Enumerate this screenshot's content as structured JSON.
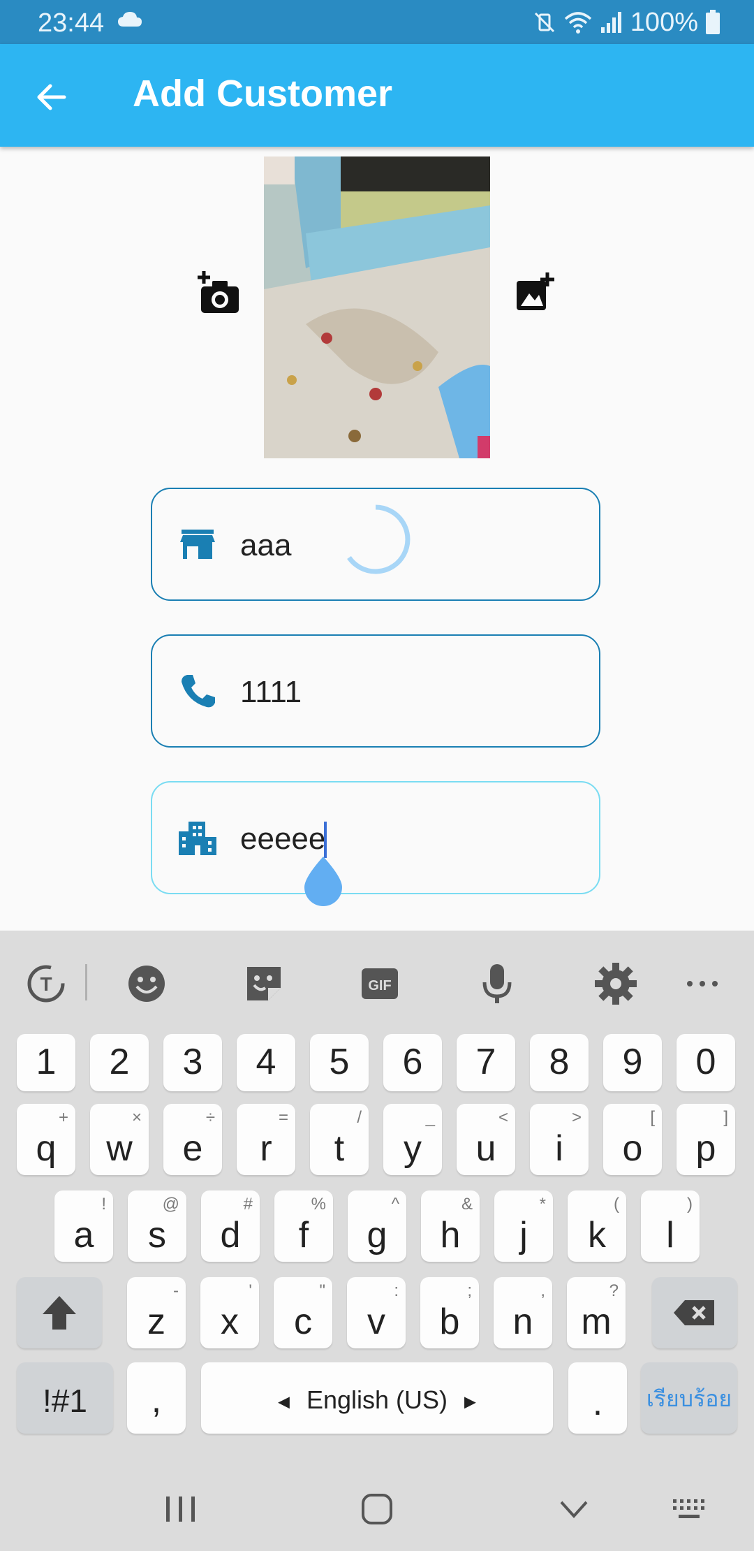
{
  "status": {
    "time": "23:44",
    "battery": "100%"
  },
  "appbar": {
    "title": "Add Customer",
    "back_icon": "arrow-back-icon"
  },
  "photo": {
    "camera_icon": "add-photo-camera-icon",
    "gallery_icon": "add-photo-gallery-icon"
  },
  "fields": {
    "shop": {
      "value": "aaa",
      "icon": "store-icon"
    },
    "phone": {
      "value": "1111",
      "icon": "phone-icon"
    },
    "address": {
      "value": "eeeee",
      "icon": "city-building-icon"
    }
  },
  "colors": {
    "appbar": "#2db5f2",
    "statusbar": "#2a8bc2",
    "field_border": "#1a7fb3",
    "field_focus": "#7adcf2",
    "accent": "#3a8fe0"
  },
  "keyboard": {
    "numbers": [
      "1",
      "2",
      "3",
      "4",
      "5",
      "6",
      "7",
      "8",
      "9",
      "0"
    ],
    "row1": [
      {
        "k": "q",
        "s": "+"
      },
      {
        "k": "w",
        "s": "×"
      },
      {
        "k": "e",
        "s": "÷"
      },
      {
        "k": "r",
        "s": "="
      },
      {
        "k": "t",
        "s": "/"
      },
      {
        "k": "y",
        "s": "_"
      },
      {
        "k": "u",
        "s": "<"
      },
      {
        "k": "i",
        "s": ">"
      },
      {
        "k": "o",
        "s": "["
      },
      {
        "k": "p",
        "s": "]"
      }
    ],
    "row2": [
      {
        "k": "a",
        "s": "!"
      },
      {
        "k": "s",
        "s": "@"
      },
      {
        "k": "d",
        "s": "#"
      },
      {
        "k": "f",
        "s": "%"
      },
      {
        "k": "g",
        "s": "^"
      },
      {
        "k": "h",
        "s": "&"
      },
      {
        "k": "j",
        "s": "*"
      },
      {
        "k": "k",
        "s": "("
      },
      {
        "k": "l",
        "s": ")"
      }
    ],
    "row3": [
      {
        "k": "z",
        "s": "-"
      },
      {
        "k": "x",
        "s": "'"
      },
      {
        "k": "c",
        "s": "\""
      },
      {
        "k": "v",
        "s": ":"
      },
      {
        "k": "b",
        "s": ";"
      },
      {
        "k": "n",
        "s": ","
      },
      {
        "k": "m",
        "s": "?"
      }
    ],
    "symbols_label": "!#1",
    "comma_label": ",",
    "space_label": "English (US)",
    "period_label": ".",
    "done_label": "เรียบร้อย"
  }
}
